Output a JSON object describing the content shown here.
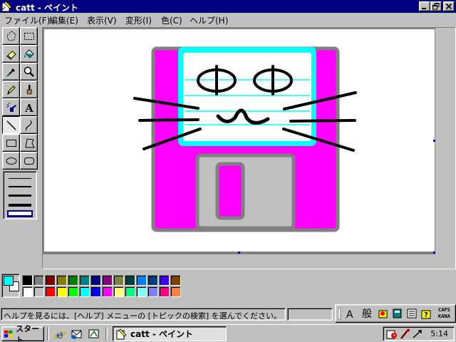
{
  "window": {
    "title": "catt - ペイント",
    "controls": {
      "minimize": "_",
      "maximize": "▫",
      "close": "×"
    }
  },
  "menu": [
    {
      "label": "ファイル(F)"
    },
    {
      "label": "編集(E)"
    },
    {
      "label": "表示(V)"
    },
    {
      "label": "変形(I)"
    },
    {
      "label": "色(C)"
    },
    {
      "label": "ヘルプ(H)"
    }
  ],
  "tools": [
    {
      "name": "free-form-select"
    },
    {
      "name": "rect-select"
    },
    {
      "name": "eraser"
    },
    {
      "name": "fill-with-color"
    },
    {
      "name": "pick-color"
    },
    {
      "name": "magnifier"
    },
    {
      "name": "pencil"
    },
    {
      "name": "brush"
    },
    {
      "name": "airbrush"
    },
    {
      "name": "text",
      "glyph": "A"
    },
    {
      "name": "line",
      "active": true
    },
    {
      "name": "curve"
    },
    {
      "name": "rectangle"
    },
    {
      "name": "polygon"
    },
    {
      "name": "ellipse"
    },
    {
      "name": "rounded-rectangle"
    }
  ],
  "line_width_selected": 5,
  "current_colors": {
    "foreground": "#00ffff",
    "background": "#ffffff"
  },
  "palette": {
    "row1": [
      "#000000",
      "#808080",
      "#800000",
      "#808000",
      "#008000",
      "#008080",
      "#000080",
      "#800080",
      "#808040",
      "#004040",
      "#0080ff",
      "#004080",
      "#4000ff",
      "#804000"
    ],
    "row2": [
      "#ffffff",
      "#c0c0c0",
      "#ff0000",
      "#ffff00",
      "#00ff00",
      "#00ffff",
      "#0000ff",
      "#ff00ff",
      "#ffff80",
      "#00ff80",
      "#80ffff",
      "#8080ff",
      "#ff0080",
      "#ff8040"
    ]
  },
  "drawing": {
    "colors": {
      "body": "#ff00ff",
      "body_outline": "#808080",
      "face_bg": "#ffffff",
      "face_frame": "#00ffff",
      "shutter": "#c0c0c0",
      "ink": "#000000"
    }
  },
  "status": {
    "help_text": "ヘルプを見るには、[ヘルプ] メニューの [トピックの検索] を選んでください。"
  },
  "ime": {
    "mode": "般",
    "caps": "CAPS",
    "kana": "KANA"
  },
  "taskbar": {
    "start_label": "スタート",
    "task_label": "catt - ペイント",
    "clock": "5:14"
  }
}
